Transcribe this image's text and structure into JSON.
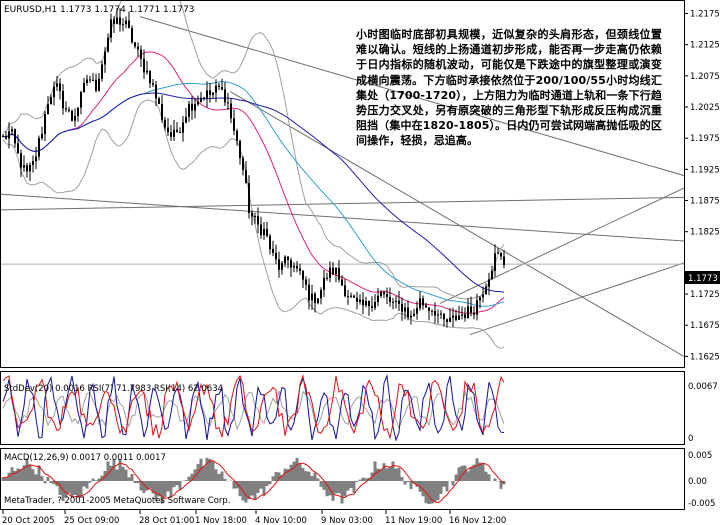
{
  "header": {
    "text": "EURUSD,H1  1.1773 1.1774 1.1771 1.1773"
  },
  "annotation": "小时图临时底部初具规模，近似复杂的头肩形态，但颈线位置难以确认。短线的上扬通道初步形成，能否再一步走高仍依赖于日内指标的随机波动，可能仅是下跌途中的旗型整理或演变成横向震荡。下方临时承接依然位于200/100/55小时均线汇集处（1700-1720），上方阻力为临时通道上轨和一条下行趋势压力交叉处，另有原突破的三角形型下轨形成反压构成沉重阻挡（集中在1820-1805）。日内仍可尝试网端高抛低吸的区间操作，轻损，忌追高。",
  "current_price_label": "1.1773",
  "indicator1_label": "StdDev(20) 0.0016  RSI(7) 71.7983  RSI(14) 62.0634",
  "indicator2_label": "MACD(12,26,9) 0.0017 0.0011 0.0017",
  "copyright": "MetaTrader, ? 2001-2005 MetaQuotes Software Corp.",
  "colors": {
    "background": "#ffffff",
    "candle": "#000000",
    "bollinger": "#a0a0a0",
    "ma_fast": "#e0207a",
    "ma_mid": "#30a0d0",
    "ma_slow": "#2020b0",
    "trendline": "#707070",
    "rsi7": "#1010a0",
    "rsi14": "#e01010",
    "stddev": "#a0a0a0",
    "macd_hist": "#808080",
    "macd_signal": "#e01010",
    "current_price_bg": "#000000"
  },
  "chart_data": [
    {
      "type": "candlestick",
      "name": "EURUSD,H1",
      "y_ticks": [
        "1.2175",
        "1.2125",
        "1.2075",
        "1.2025",
        "1.1975",
        "1.1925",
        "1.1875",
        "1.1825",
        "1.1725",
        "1.1675",
        "1.1625"
      ],
      "ylim": [
        1.1608,
        1.2195
      ],
      "current_price": 1.1773,
      "x_ticks": [
        "20 Oct 2005",
        "25 Oct 09:00",
        "28 Oct 01:00",
        "1 Nov 18:00",
        "4 Nov 10:00",
        "9 Nov 03:00",
        "11 Nov 19:00",
        "16 Nov 12:00"
      ],
      "close_path": [
        1.1975,
        1.1985,
        1.1945,
        1.1915,
        1.1935,
        1.1985,
        1.2045,
        1.2055,
        1.2025,
        1.2005,
        1.2035,
        1.2075,
        1.2055,
        1.2105,
        1.2155,
        1.2165,
        1.2155,
        1.2125,
        1.2095,
        1.2075,
        1.2035,
        1.1995,
        1.1975,
        1.1995,
        1.2025,
        1.2035,
        1.2045,
        1.2045,
        1.2055,
        1.204,
        1.1985,
        1.1935,
        1.1855,
        1.1835,
        1.1825,
        1.1785,
        1.1765,
        1.178,
        1.1765,
        1.1745,
        1.1715,
        1.1725,
        1.1755,
        1.1765,
        1.174,
        1.172,
        1.1705,
        1.1705,
        1.1715,
        1.1725,
        1.1715,
        1.1705,
        1.1705,
        1.1685,
        1.1715,
        1.1705,
        1.17,
        1.168,
        1.168,
        1.169,
        1.1695,
        1.17,
        1.1725,
        1.1755,
        1.179,
        1.1775
      ],
      "indicators": [
        "Bollinger Bands",
        "Moving Average",
        "Moving Average",
        "Moving Average",
        "Trendline",
        "Trendline"
      ]
    },
    {
      "type": "line",
      "name": "StdDev / RSI",
      "y_ticks": [
        "0.0067",
        "0"
      ],
      "series": [
        {
          "name": "StdDev(20)",
          "last": 0.0016
        },
        {
          "name": "RSI(7)",
          "last": 71.7983
        },
        {
          "name": "RSI(14)",
          "last": 62.0634
        }
      ]
    },
    {
      "type": "bar",
      "name": "MACD(12,26,9)",
      "y_ticks": [
        "0.005",
        "0.00",
        "-0.005"
      ],
      "series": [
        {
          "name": "MACD",
          "last": 0.0017
        },
        {
          "name": "Signal",
          "last": 0.0011
        }
      ]
    }
  ]
}
